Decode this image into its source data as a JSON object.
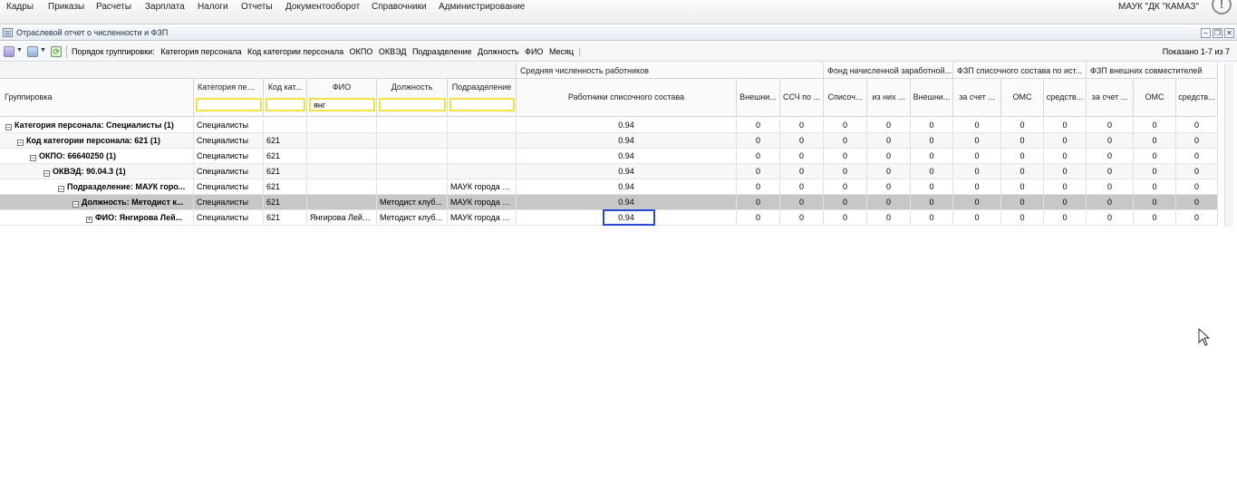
{
  "menu": [
    "Кадры",
    "Приказы",
    "Расчеты",
    "Зарплата",
    "Налоги",
    "Отчеты",
    "Документооборот",
    "Справочники",
    "Администрирование"
  ],
  "org_name": "МАУК \"ДК \"КАМАЗ\"",
  "alert_icon": "!",
  "window": {
    "title": "Отраслевой отчет о численности и ФЗП"
  },
  "toolbar": {
    "group_order_label": "Порядок группировки:",
    "group_chips": [
      "Категория персонала",
      "Код категории персонала",
      "ОКПО",
      "ОКВЭД",
      "Подразделение",
      "Должность",
      "ФИО",
      "Месяц"
    ],
    "paging": "Показано 1-7 из 7"
  },
  "grid": {
    "top_headers": {
      "avg": "Средняя численность работников",
      "fund": "Фонд начисленной заработной...",
      "fzp_list": "ФЗП списочного состава по ист...",
      "fzp_ext": "ФЗП внешних совместителей"
    },
    "columns": {
      "group": "Группировка",
      "cat": "Категория перс...",
      "code": "Код кат...",
      "fio": "ФИО",
      "pos": "Должность",
      "dept": "Подразделение",
      "workers": "Работники списочного состава",
      "n1": "Внешни...",
      "n2": "ССЧ по ...",
      "n3": "Списоч...",
      "n4": "из них ...",
      "n5": "Внешни...",
      "n6": "за счет ...",
      "n7": "ОМС",
      "n8": "средств...",
      "n9": "за счет ...",
      "n10": "ОМС",
      "n11": "средств..."
    },
    "filters": {
      "fio": "янг"
    },
    "rows": [
      {
        "label": "Категория персонала: Специалисты (1)",
        "cat": "Специалисты",
        "code": "",
        "fio": "",
        "pos": "",
        "dept": "",
        "workers": "0.94",
        "nums": [
          "0",
          "0",
          "0",
          "0",
          "0",
          "0",
          "0",
          "0",
          "0",
          "0",
          "0"
        ]
      },
      {
        "label": "Код категории персонала: 621 (1)",
        "cat": "Специалисты",
        "code": "621",
        "fio": "",
        "pos": "",
        "dept": "",
        "workers": "0.94",
        "nums": [
          "0",
          "0",
          "0",
          "0",
          "0",
          "0",
          "0",
          "0",
          "0",
          "0",
          "0"
        ]
      },
      {
        "label": "ОКПО: 66640250 (1)",
        "cat": "Специалисты",
        "code": "621",
        "fio": "",
        "pos": "",
        "dept": "",
        "workers": "0.94",
        "nums": [
          "0",
          "0",
          "0",
          "0",
          "0",
          "0",
          "0",
          "0",
          "0",
          "0",
          "0"
        ]
      },
      {
        "label": "ОКВЭД: 90.04.3 (1)",
        "cat": "Специалисты",
        "code": "621",
        "fio": "",
        "pos": "",
        "dept": "",
        "workers": "0.94",
        "nums": [
          "0",
          "0",
          "0",
          "0",
          "0",
          "0",
          "0",
          "0",
          "0",
          "0",
          "0"
        ]
      },
      {
        "label": "Подразделение: МАУК горо...",
        "cat": "Специалисты",
        "code": "621",
        "fio": "",
        "pos": "",
        "dept": "МАУК города Н...",
        "workers": "0.94",
        "nums": [
          "0",
          "0",
          "0",
          "0",
          "0",
          "0",
          "0",
          "0",
          "0",
          "0",
          "0"
        ]
      },
      {
        "label": "Должность: Методист к...",
        "cat": "Специалисты",
        "code": "621",
        "fio": "",
        "pos": "Методист клуб...",
        "dept": "МАУК города Н...",
        "workers": "0.94",
        "nums": [
          "0",
          "0",
          "0",
          "0",
          "0",
          "0",
          "0",
          "0",
          "0",
          "0",
          "0"
        ]
      },
      {
        "label": "ФИО: Янгирова Лей...",
        "cat": "Специалисты",
        "code": "621",
        "fio": "Янгирова Лейл...",
        "pos": "Методист клуб...",
        "dept": "МАУК города Н...",
        "workers": "0.94",
        "nums": [
          "0",
          "0",
          "0",
          "0",
          "0",
          "0",
          "0",
          "0",
          "0",
          "0",
          "0"
        ]
      }
    ]
  }
}
